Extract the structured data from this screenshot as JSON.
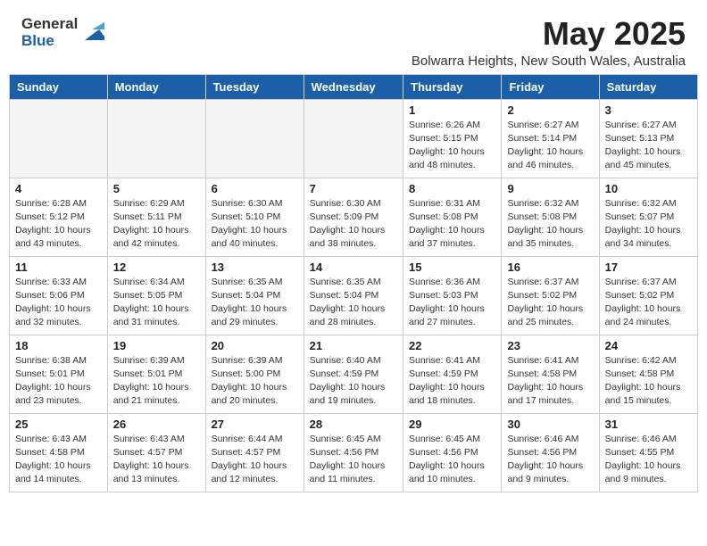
{
  "header": {
    "logo_general": "General",
    "logo_blue": "Blue",
    "month_year": "May 2025",
    "location": "Bolwarra Heights, New South Wales, Australia"
  },
  "days_of_week": [
    "Sunday",
    "Monday",
    "Tuesday",
    "Wednesday",
    "Thursday",
    "Friday",
    "Saturday"
  ],
  "weeks": [
    [
      {
        "day": "",
        "empty": true
      },
      {
        "day": "",
        "empty": true
      },
      {
        "day": "",
        "empty": true
      },
      {
        "day": "",
        "empty": true
      },
      {
        "day": "1",
        "sunrise": "6:26 AM",
        "sunset": "5:15 PM",
        "daylight": "10 hours and 48 minutes."
      },
      {
        "day": "2",
        "sunrise": "6:27 AM",
        "sunset": "5:14 PM",
        "daylight": "10 hours and 46 minutes."
      },
      {
        "day": "3",
        "sunrise": "6:27 AM",
        "sunset": "5:13 PM",
        "daylight": "10 hours and 45 minutes."
      }
    ],
    [
      {
        "day": "4",
        "sunrise": "6:28 AM",
        "sunset": "5:12 PM",
        "daylight": "10 hours and 43 minutes."
      },
      {
        "day": "5",
        "sunrise": "6:29 AM",
        "sunset": "5:11 PM",
        "daylight": "10 hours and 42 minutes."
      },
      {
        "day": "6",
        "sunrise": "6:30 AM",
        "sunset": "5:10 PM",
        "daylight": "10 hours and 40 minutes."
      },
      {
        "day": "7",
        "sunrise": "6:30 AM",
        "sunset": "5:09 PM",
        "daylight": "10 hours and 38 minutes."
      },
      {
        "day": "8",
        "sunrise": "6:31 AM",
        "sunset": "5:08 PM",
        "daylight": "10 hours and 37 minutes."
      },
      {
        "day": "9",
        "sunrise": "6:32 AM",
        "sunset": "5:08 PM",
        "daylight": "10 hours and 35 minutes."
      },
      {
        "day": "10",
        "sunrise": "6:32 AM",
        "sunset": "5:07 PM",
        "daylight": "10 hours and 34 minutes."
      }
    ],
    [
      {
        "day": "11",
        "sunrise": "6:33 AM",
        "sunset": "5:06 PM",
        "daylight": "10 hours and 32 minutes."
      },
      {
        "day": "12",
        "sunrise": "6:34 AM",
        "sunset": "5:05 PM",
        "daylight": "10 hours and 31 minutes."
      },
      {
        "day": "13",
        "sunrise": "6:35 AM",
        "sunset": "5:04 PM",
        "daylight": "10 hours and 29 minutes."
      },
      {
        "day": "14",
        "sunrise": "6:35 AM",
        "sunset": "5:04 PM",
        "daylight": "10 hours and 28 minutes."
      },
      {
        "day": "15",
        "sunrise": "6:36 AM",
        "sunset": "5:03 PM",
        "daylight": "10 hours and 27 minutes."
      },
      {
        "day": "16",
        "sunrise": "6:37 AM",
        "sunset": "5:02 PM",
        "daylight": "10 hours and 25 minutes."
      },
      {
        "day": "17",
        "sunrise": "6:37 AM",
        "sunset": "5:02 PM",
        "daylight": "10 hours and 24 minutes."
      }
    ],
    [
      {
        "day": "18",
        "sunrise": "6:38 AM",
        "sunset": "5:01 PM",
        "daylight": "10 hours and 23 minutes."
      },
      {
        "day": "19",
        "sunrise": "6:39 AM",
        "sunset": "5:01 PM",
        "daylight": "10 hours and 21 minutes."
      },
      {
        "day": "20",
        "sunrise": "6:39 AM",
        "sunset": "5:00 PM",
        "daylight": "10 hours and 20 minutes."
      },
      {
        "day": "21",
        "sunrise": "6:40 AM",
        "sunset": "4:59 PM",
        "daylight": "10 hours and 19 minutes."
      },
      {
        "day": "22",
        "sunrise": "6:41 AM",
        "sunset": "4:59 PM",
        "daylight": "10 hours and 18 minutes."
      },
      {
        "day": "23",
        "sunrise": "6:41 AM",
        "sunset": "4:58 PM",
        "daylight": "10 hours and 17 minutes."
      },
      {
        "day": "24",
        "sunrise": "6:42 AM",
        "sunset": "4:58 PM",
        "daylight": "10 hours and 15 minutes."
      }
    ],
    [
      {
        "day": "25",
        "sunrise": "6:43 AM",
        "sunset": "4:58 PM",
        "daylight": "10 hours and 14 minutes."
      },
      {
        "day": "26",
        "sunrise": "6:43 AM",
        "sunset": "4:57 PM",
        "daylight": "10 hours and 13 minutes."
      },
      {
        "day": "27",
        "sunrise": "6:44 AM",
        "sunset": "4:57 PM",
        "daylight": "10 hours and 12 minutes."
      },
      {
        "day": "28",
        "sunrise": "6:45 AM",
        "sunset": "4:56 PM",
        "daylight": "10 hours and 11 minutes."
      },
      {
        "day": "29",
        "sunrise": "6:45 AM",
        "sunset": "4:56 PM",
        "daylight": "10 hours and 10 minutes."
      },
      {
        "day": "30",
        "sunrise": "6:46 AM",
        "sunset": "4:56 PM",
        "daylight": "10 hours and 9 minutes."
      },
      {
        "day": "31",
        "sunrise": "6:46 AM",
        "sunset": "4:55 PM",
        "daylight": "10 hours and 9 minutes."
      }
    ]
  ]
}
